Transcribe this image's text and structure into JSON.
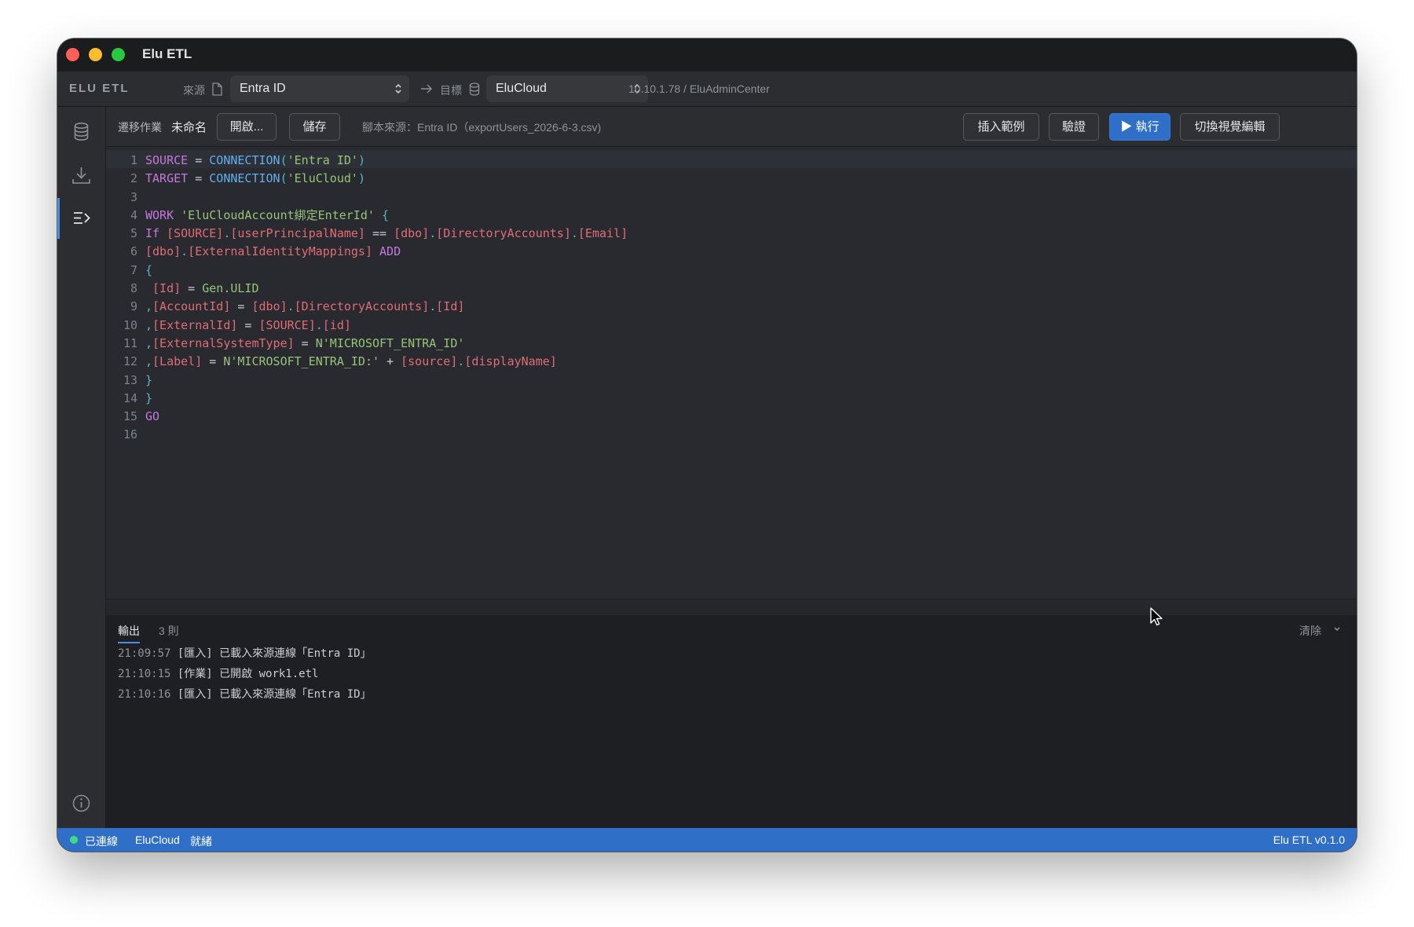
{
  "window": {
    "title": "Elu ETL"
  },
  "connection_bar": {
    "brand": "ELU ETL",
    "source_label": "來源",
    "source_value": "Entra ID",
    "target_label": "目標",
    "target_value": "EluCloud",
    "db_path": "10.10.1.78 / EluAdminCenter"
  },
  "toolbar": {
    "job_label": "遷移作業",
    "job_name": "未命名",
    "open_label": "開啟...",
    "save_label": "儲存",
    "script_source": "腳本來源：Entra ID（exportUsers_2026-6-3.csv)",
    "insert_example_label": "插入範例",
    "validate_label": "驗證",
    "run_label": "▶ 執行",
    "toggle_visual_label": "切換視覺編輯"
  },
  "editor": {
    "line_numbers": [
      "1",
      "2",
      "3",
      "4",
      "5",
      "6",
      "7",
      "8",
      "9",
      "10",
      "11",
      "12",
      "13",
      "14",
      "15",
      "16"
    ],
    "lines": [
      [
        {
          "c": "k",
          "t": "SOURCE"
        },
        {
          "c": "t",
          "t": " = "
        },
        {
          "c": "f",
          "t": "CONNECTION"
        },
        {
          "c": "p",
          "t": "("
        },
        {
          "c": "s",
          "t": "'Entra ID'"
        },
        {
          "c": "p",
          "t": ")"
        }
      ],
      [
        {
          "c": "k",
          "t": "TARGET"
        },
        {
          "c": "t",
          "t": " = "
        },
        {
          "c": "f",
          "t": "CONNECTION"
        },
        {
          "c": "p",
          "t": "("
        },
        {
          "c": "s",
          "t": "'EluCloud'"
        },
        {
          "c": "p",
          "t": ")"
        }
      ],
      [],
      [
        {
          "c": "k",
          "t": "WORK"
        },
        {
          "c": "t",
          "t": " "
        },
        {
          "c": "s",
          "t": "'EluCloudAccount綁定EnterId'"
        },
        {
          "c": "t",
          "t": " "
        },
        {
          "c": "p",
          "t": "{"
        }
      ],
      [
        {
          "c": "k",
          "t": "If"
        },
        {
          "c": "t",
          "t": " "
        },
        {
          "c": "b",
          "t": "[SOURCE]"
        },
        {
          "c": "p",
          "t": "."
        },
        {
          "c": "b",
          "t": "[userPrincipalName]"
        },
        {
          "c": "t",
          "t": " == "
        },
        {
          "c": "b",
          "t": "[dbo]"
        },
        {
          "c": "p",
          "t": "."
        },
        {
          "c": "b",
          "t": "[DirectoryAccounts]"
        },
        {
          "c": "p",
          "t": "."
        },
        {
          "c": "b",
          "t": "[Email]"
        }
      ],
      [
        {
          "c": "b",
          "t": "[dbo]"
        },
        {
          "c": "p",
          "t": "."
        },
        {
          "c": "b",
          "t": "[ExternalIdentityMappings]"
        },
        {
          "c": "t",
          "t": " "
        },
        {
          "c": "k",
          "t": "ADD"
        }
      ],
      [
        {
          "c": "p",
          "t": "{"
        }
      ],
      [
        {
          "c": "t",
          "t": " "
        },
        {
          "c": "b",
          "t": "[Id]"
        },
        {
          "c": "t",
          "t": " = "
        },
        {
          "c": "s",
          "t": "Gen.ULID"
        }
      ],
      [
        {
          "c": "p",
          "t": ","
        },
        {
          "c": "b",
          "t": "[AccountId]"
        },
        {
          "c": "t",
          "t": " = "
        },
        {
          "c": "b",
          "t": "[dbo]"
        },
        {
          "c": "p",
          "t": "."
        },
        {
          "c": "b",
          "t": "[DirectoryAccounts]"
        },
        {
          "c": "p",
          "t": "."
        },
        {
          "c": "b",
          "t": "[Id]"
        }
      ],
      [
        {
          "c": "p",
          "t": ","
        },
        {
          "c": "b",
          "t": "[ExternalId]"
        },
        {
          "c": "t",
          "t": " = "
        },
        {
          "c": "b",
          "t": "[SOURCE]"
        },
        {
          "c": "p",
          "t": "."
        },
        {
          "c": "b",
          "t": "[id]"
        }
      ],
      [
        {
          "c": "p",
          "t": ","
        },
        {
          "c": "b",
          "t": "[ExternalSystemType]"
        },
        {
          "c": "t",
          "t": " = "
        },
        {
          "c": "s",
          "t": "N'MICROSOFT_ENTRA_ID'"
        }
      ],
      [
        {
          "c": "p",
          "t": ","
        },
        {
          "c": "b",
          "t": "[Label]"
        },
        {
          "c": "t",
          "t": " = "
        },
        {
          "c": "s",
          "t": "N'MICROSOFT_ENTRA_ID:'"
        },
        {
          "c": "t",
          "t": " + "
        },
        {
          "c": "b",
          "t": "[source]"
        },
        {
          "c": "p",
          "t": "."
        },
        {
          "c": "b",
          "t": "[displayName]"
        }
      ],
      [
        {
          "c": "p",
          "t": "}"
        }
      ],
      [
        {
          "c": "p",
          "t": "}"
        }
      ],
      [
        {
          "c": "k",
          "t": "GO"
        }
      ],
      []
    ]
  },
  "output": {
    "tab_label": "輸出",
    "count": "3 則",
    "clear_label": "清除",
    "logs": [
      {
        "time": "21:09:57",
        "text": " [匯入] 已載入來源連線「Entra ID」"
      },
      {
        "time": "21:10:15",
        "text": " [作業] 已開啟 work1.etl"
      },
      {
        "time": "21:10:16",
        "text": " [匯入] 已載入來源連線「Entra ID」"
      }
    ]
  },
  "status": {
    "connection_state": "已連線",
    "connection_name": "EluCloud",
    "state": "就緒",
    "version": "Elu ETL v0.1.0"
  },
  "icons": [
    "database-icon",
    "download-icon",
    "script-icon",
    "info-icon",
    "file-icon",
    "arrow-right-icon",
    "chevron-updown-icon",
    "chevron-down-icon",
    "mouse-cursor-icon"
  ],
  "colors": {
    "accent": "#2f6fc7",
    "keyword": "#c678dd",
    "function": "#61afef",
    "string": "#98c379",
    "identifier": "#e06c75"
  }
}
